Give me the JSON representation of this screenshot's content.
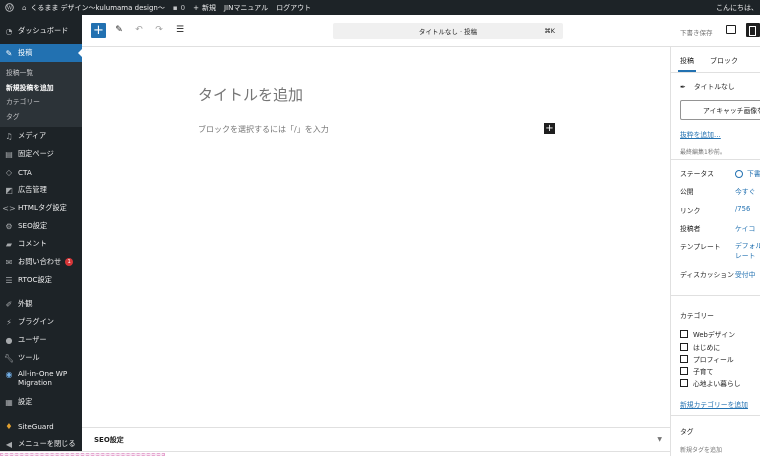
{
  "admin_bar": {
    "site_name": "くるまま デザイン〜kulumama design〜",
    "comments_count": "0",
    "new_label": "新規",
    "manual_label": "JINマニュアル",
    "logout_label": "ログアウト",
    "greeting": "こんにちは、"
  },
  "sidebar": {
    "dashboard": "ダッシュボード",
    "posts": "投稿",
    "posts_sub": [
      "投稿一覧",
      "新規投稿を追加",
      "カテゴリー",
      "タグ"
    ],
    "items_a": [
      "メディア",
      "固定ページ",
      "CTA",
      "広告管理",
      "HTMLタグ設定",
      "SEO設定",
      "コメント"
    ],
    "contact": "お問い合わせ",
    "contact_badge": "1",
    "rtoc": "RTOC設定",
    "items_b": [
      "外観",
      "プラグイン",
      "ユーザー",
      "ツール"
    ],
    "migration": [
      "All-in-One WP",
      "Migration"
    ],
    "settings": "設定",
    "siteguard": "SiteGuard",
    "collapse": "メニューを閉じる"
  },
  "toolbar": {
    "add_symbol": "+",
    "command_title": "タイトルなし · 投稿",
    "command_shortcut": "⌘K",
    "save_draft": "下書き保存"
  },
  "editor": {
    "title_placeholder": "タイトルを追加",
    "block_placeholder": "ブロックを選択するには「/」を入力",
    "inserter_symbol": "+"
  },
  "metabox": {
    "label": "SEO設定"
  },
  "panel": {
    "tabs": [
      "投稿",
      "ブロック"
    ],
    "post_title": "タイトルなし",
    "featured_image": "アイキャッチ画像を",
    "excerpt_link": "抜粋を追加…",
    "last_edited": "最終編集1秒前。",
    "rows": [
      {
        "label": "ステータス",
        "value": "下書"
      },
      {
        "label": "公開",
        "value": "今すぐ"
      },
      {
        "label": "リンク",
        "value": "/756"
      },
      {
        "label": "投稿者",
        "value": "ケイコ"
      },
      {
        "label": "テンプレート",
        "value": [
          "デフォル",
          "レート"
        ]
      },
      {
        "label": "ディスカッション",
        "value": "受付中"
      }
    ],
    "categories_title": "カテゴリー",
    "categories": [
      "Webデザイン",
      "はじめに",
      "プロフィール",
      "子育て",
      "心地よい暮らし"
    ],
    "new_category": "新規カテゴリーを追加",
    "tags_title": "タグ",
    "tags_hint": "新規タグを追加"
  },
  "colors": {
    "admin_dark": "#1d2327",
    "accent": "#2271b1",
    "badge": "#d63638"
  }
}
